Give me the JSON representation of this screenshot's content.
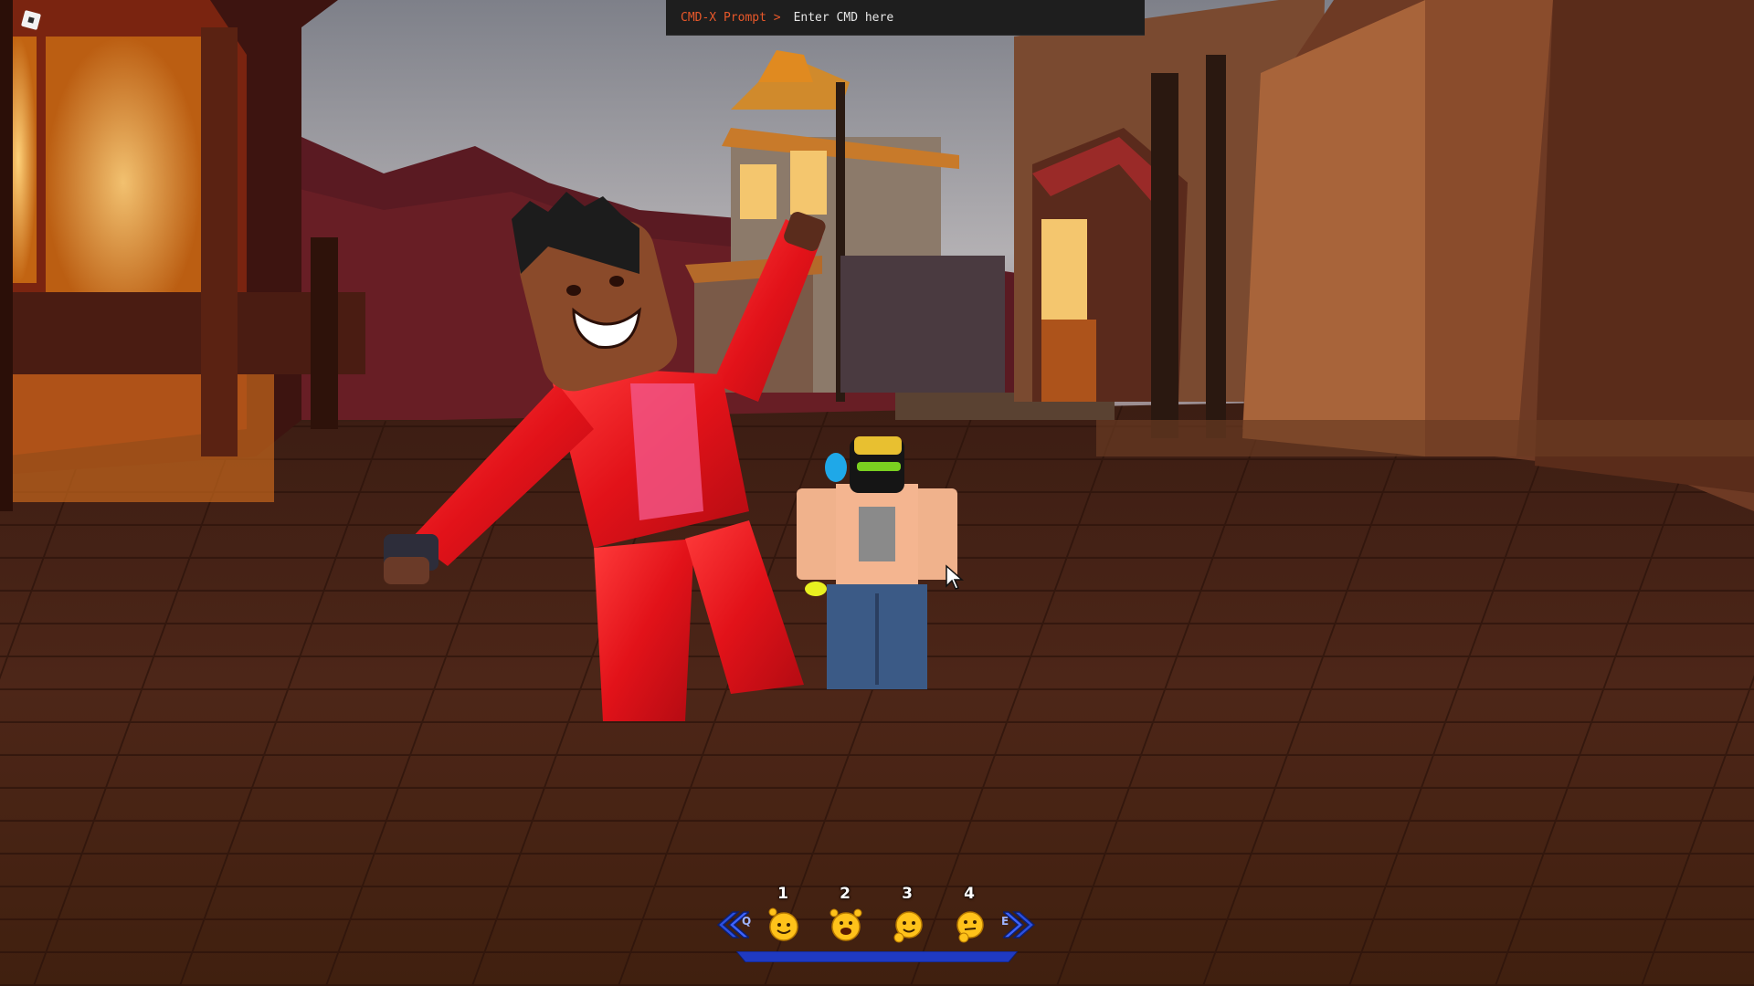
{
  "app": {
    "logo_icon": "roblox-logo-icon"
  },
  "cmd_bar": {
    "prompt_label": "CMD-X Prompt >",
    "input_placeholder": "Enter CMD here",
    "input_value": ""
  },
  "emote_bar": {
    "prev_key": "Q",
    "next_key": "E",
    "slots": [
      {
        "number": "1",
        "icon": "waving-emote-icon"
      },
      {
        "number": "2",
        "icon": "cheering-emote-icon"
      },
      {
        "number": "3",
        "icon": "dancing-emote-icon"
      },
      {
        "number": "4",
        "icon": "thinking-emote-icon"
      }
    ],
    "colors": {
      "arrow": "#2b4fe0",
      "bar": "#1f3ac2",
      "face": "#ffc21a"
    }
  },
  "scene": {
    "sky_top": "#8a8d96",
    "ground": "#4a2418",
    "left_character_outfit": "#e8141a",
    "right_character_shirt": "#f0b28c"
  }
}
